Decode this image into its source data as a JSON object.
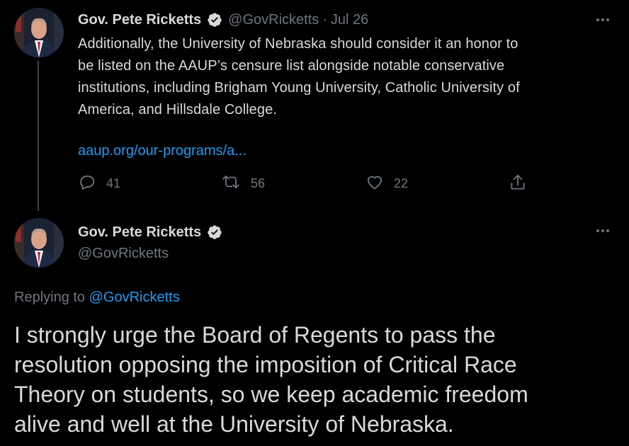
{
  "tweet_1": {
    "display_name": "Gov. Pete Ricketts",
    "handle": "@GovRicketts",
    "separator": "·",
    "date": "Jul 26",
    "text_lines": [
      "Additionally, the University of Nebraska should consider it an honor to",
      "be listed on the AAUP’s censure list alongside notable conservative",
      "institutions, including Brigham Young University, Catholic University of",
      "America, and Hillsdale College."
    ],
    "link": "aaup.org/our-programs/a...",
    "reply_count": "41",
    "retweet_count": "56",
    "like_count": "22"
  },
  "tweet_2": {
    "display_name": "Gov. Pete Ricketts",
    "handle": "@GovRicketts",
    "replying_prefix": "Replying to",
    "replying_to": "@GovRicketts",
    "text_lines": [
      "I strongly urge the Board of Regents to pass the",
      "resolution opposing the imposition of Critical Race",
      "Theory on students, so we keep academic freedom",
      "alive and well at the University of Nebraska."
    ]
  },
  "icons": {
    "verified": "verified-badge-icon",
    "more": "more-horizontal-icon",
    "reply": "reply-icon",
    "retweet": "retweet-icon",
    "like": "heart-icon",
    "share": "share-icon"
  },
  "colors": {
    "background": "#000000",
    "text": "#d9d9d9",
    "muted": "#6e767d",
    "link": "#1d9bf0",
    "thread_line": "#3d4248"
  }
}
